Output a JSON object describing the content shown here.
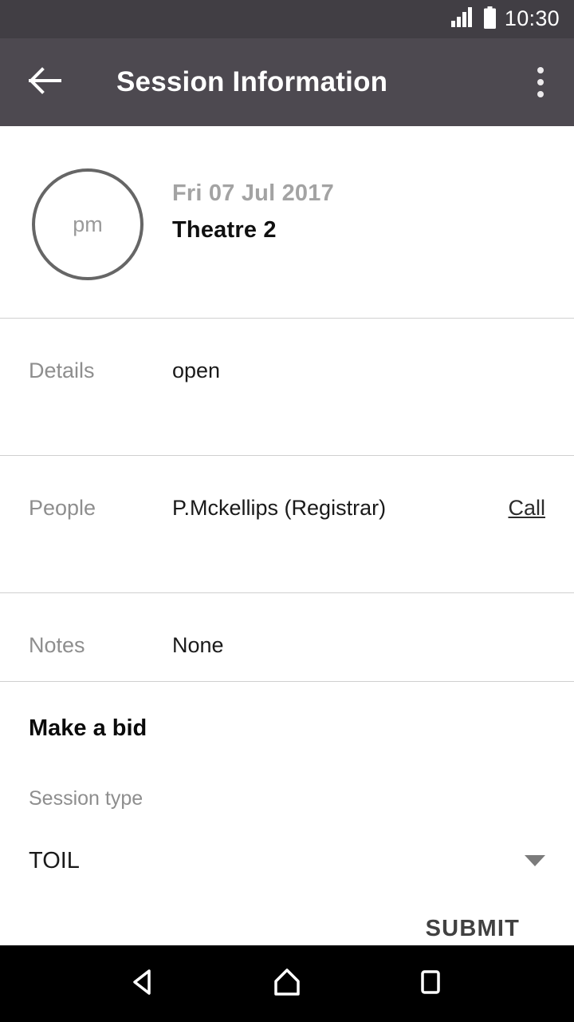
{
  "status_bar": {
    "time": "10:30",
    "signal_icon": "signal-bars-icon",
    "battery_icon": "battery-full-icon",
    "background_color": "#413e44"
  },
  "app_bar": {
    "title": "Session Information",
    "back_icon": "back-arrow-icon",
    "overflow_icon": "more-vertical-icon",
    "background_color": "#4d4950"
  },
  "session_header": {
    "period": "pm",
    "date": "Fri 07 Jul 2017",
    "room": "Theatre 2"
  },
  "info_rows": [
    {
      "label": "Details",
      "value": "open",
      "action": null
    },
    {
      "label": "People",
      "value": "P.Mckellips (Registrar)",
      "action": "Call"
    },
    {
      "label": "Notes",
      "value": "None",
      "action": null
    }
  ],
  "bid_section": {
    "title": "Make a bid",
    "session_type_label": "Session type",
    "session_type_value": "TOIL",
    "dropdown_icon": "chevron-down-icon",
    "submit_label": "SUBMIT"
  },
  "nav_bar": {
    "back_icon": "nav-back-triangle-icon",
    "home_icon": "nav-home-icon",
    "recents_icon": "nav-recents-square-icon",
    "background_color": "#000000"
  }
}
